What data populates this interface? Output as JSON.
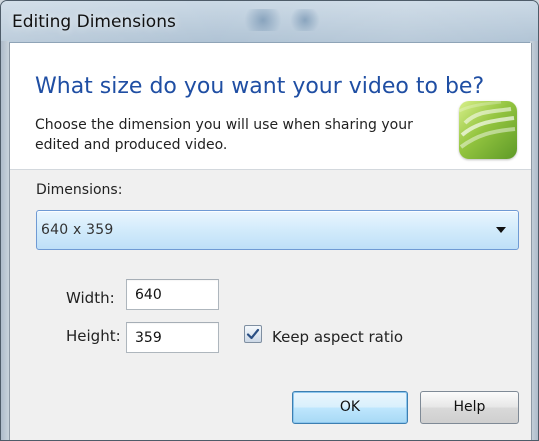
{
  "window": {
    "title": "Editing Dimensions"
  },
  "header": {
    "heading": "What size do you want your video to be?",
    "description": "Choose the dimension you will use when sharing your edited and produced video.",
    "logo_icon": "camtasia-logo"
  },
  "form": {
    "dimensions_label": "Dimensions:",
    "dimensions_selected": "640 x 359",
    "width_label": "Width:",
    "width_value": "640",
    "height_label": "Height:",
    "height_value": "359",
    "keep_aspect_label": "Keep aspect ratio",
    "keep_aspect_checked": true
  },
  "buttons": {
    "ok_label": "OK",
    "help_label": "Help"
  },
  "colors": {
    "heading": "#1f4ea3",
    "select_border": "#6f9ad4",
    "ok_border": "#3c7fb1"
  }
}
